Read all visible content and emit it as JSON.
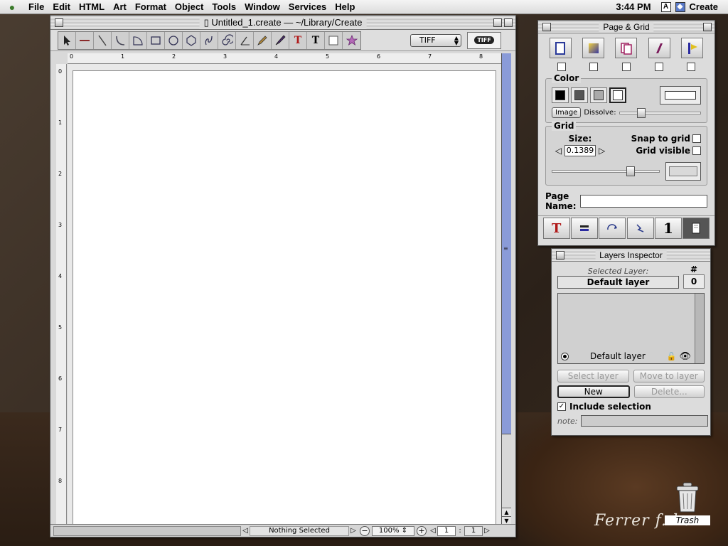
{
  "menubar": {
    "apple": "",
    "items": [
      "File",
      "Edit",
      "HTML",
      "Art",
      "Format",
      "Object",
      "Tools",
      "Window",
      "Services",
      "Help"
    ],
    "clock": "3:44 PM",
    "app_name": "Create"
  },
  "document": {
    "title": "Untitled_1.create — ~/Library/Create",
    "format_select": "TIFF",
    "format_badge": "TIFF",
    "ruler_h": [
      "0",
      "1",
      "2",
      "3",
      "4",
      "5",
      "6",
      "7",
      "8"
    ],
    "ruler_v": [
      "0",
      "1",
      "2",
      "3",
      "4",
      "5",
      "6",
      "7",
      "8"
    ],
    "status_label": "Nothing Selected",
    "zoom": "100%",
    "page_current": "1",
    "page_sep": ":",
    "page_total": "1"
  },
  "page_grid": {
    "title": "Page & Grid",
    "color_label": "Color",
    "image_button": "Image",
    "dissolve_label": "Dissolve:",
    "grid_label": "Grid",
    "size_label": "Size:",
    "size_value": "0.1389",
    "snap_label": "Snap to grid",
    "visible_label": "Grid visible",
    "page_name_label": "Page Name:",
    "page_name_value": ""
  },
  "layers": {
    "title": "Layers Inspector",
    "selected_caption": "Selected Layer:",
    "selected_value": "Default layer",
    "count_label": "#",
    "count_value": "0",
    "layer_row": "Default layer",
    "select_layer": "Select layer",
    "move_to_layer": "Move to layer",
    "new": "New",
    "delete": "Delete...",
    "include_selection": "Include selection",
    "note_label": "note:",
    "note_value": ""
  },
  "desktop": {
    "trash_label": "Trash",
    "signature": "Ferrer f. ha"
  },
  "colors": {
    "scroll_accent": "#8a9bd8",
    "text_tool_red": "#b01818",
    "star_purple": "#9a3aa0"
  }
}
